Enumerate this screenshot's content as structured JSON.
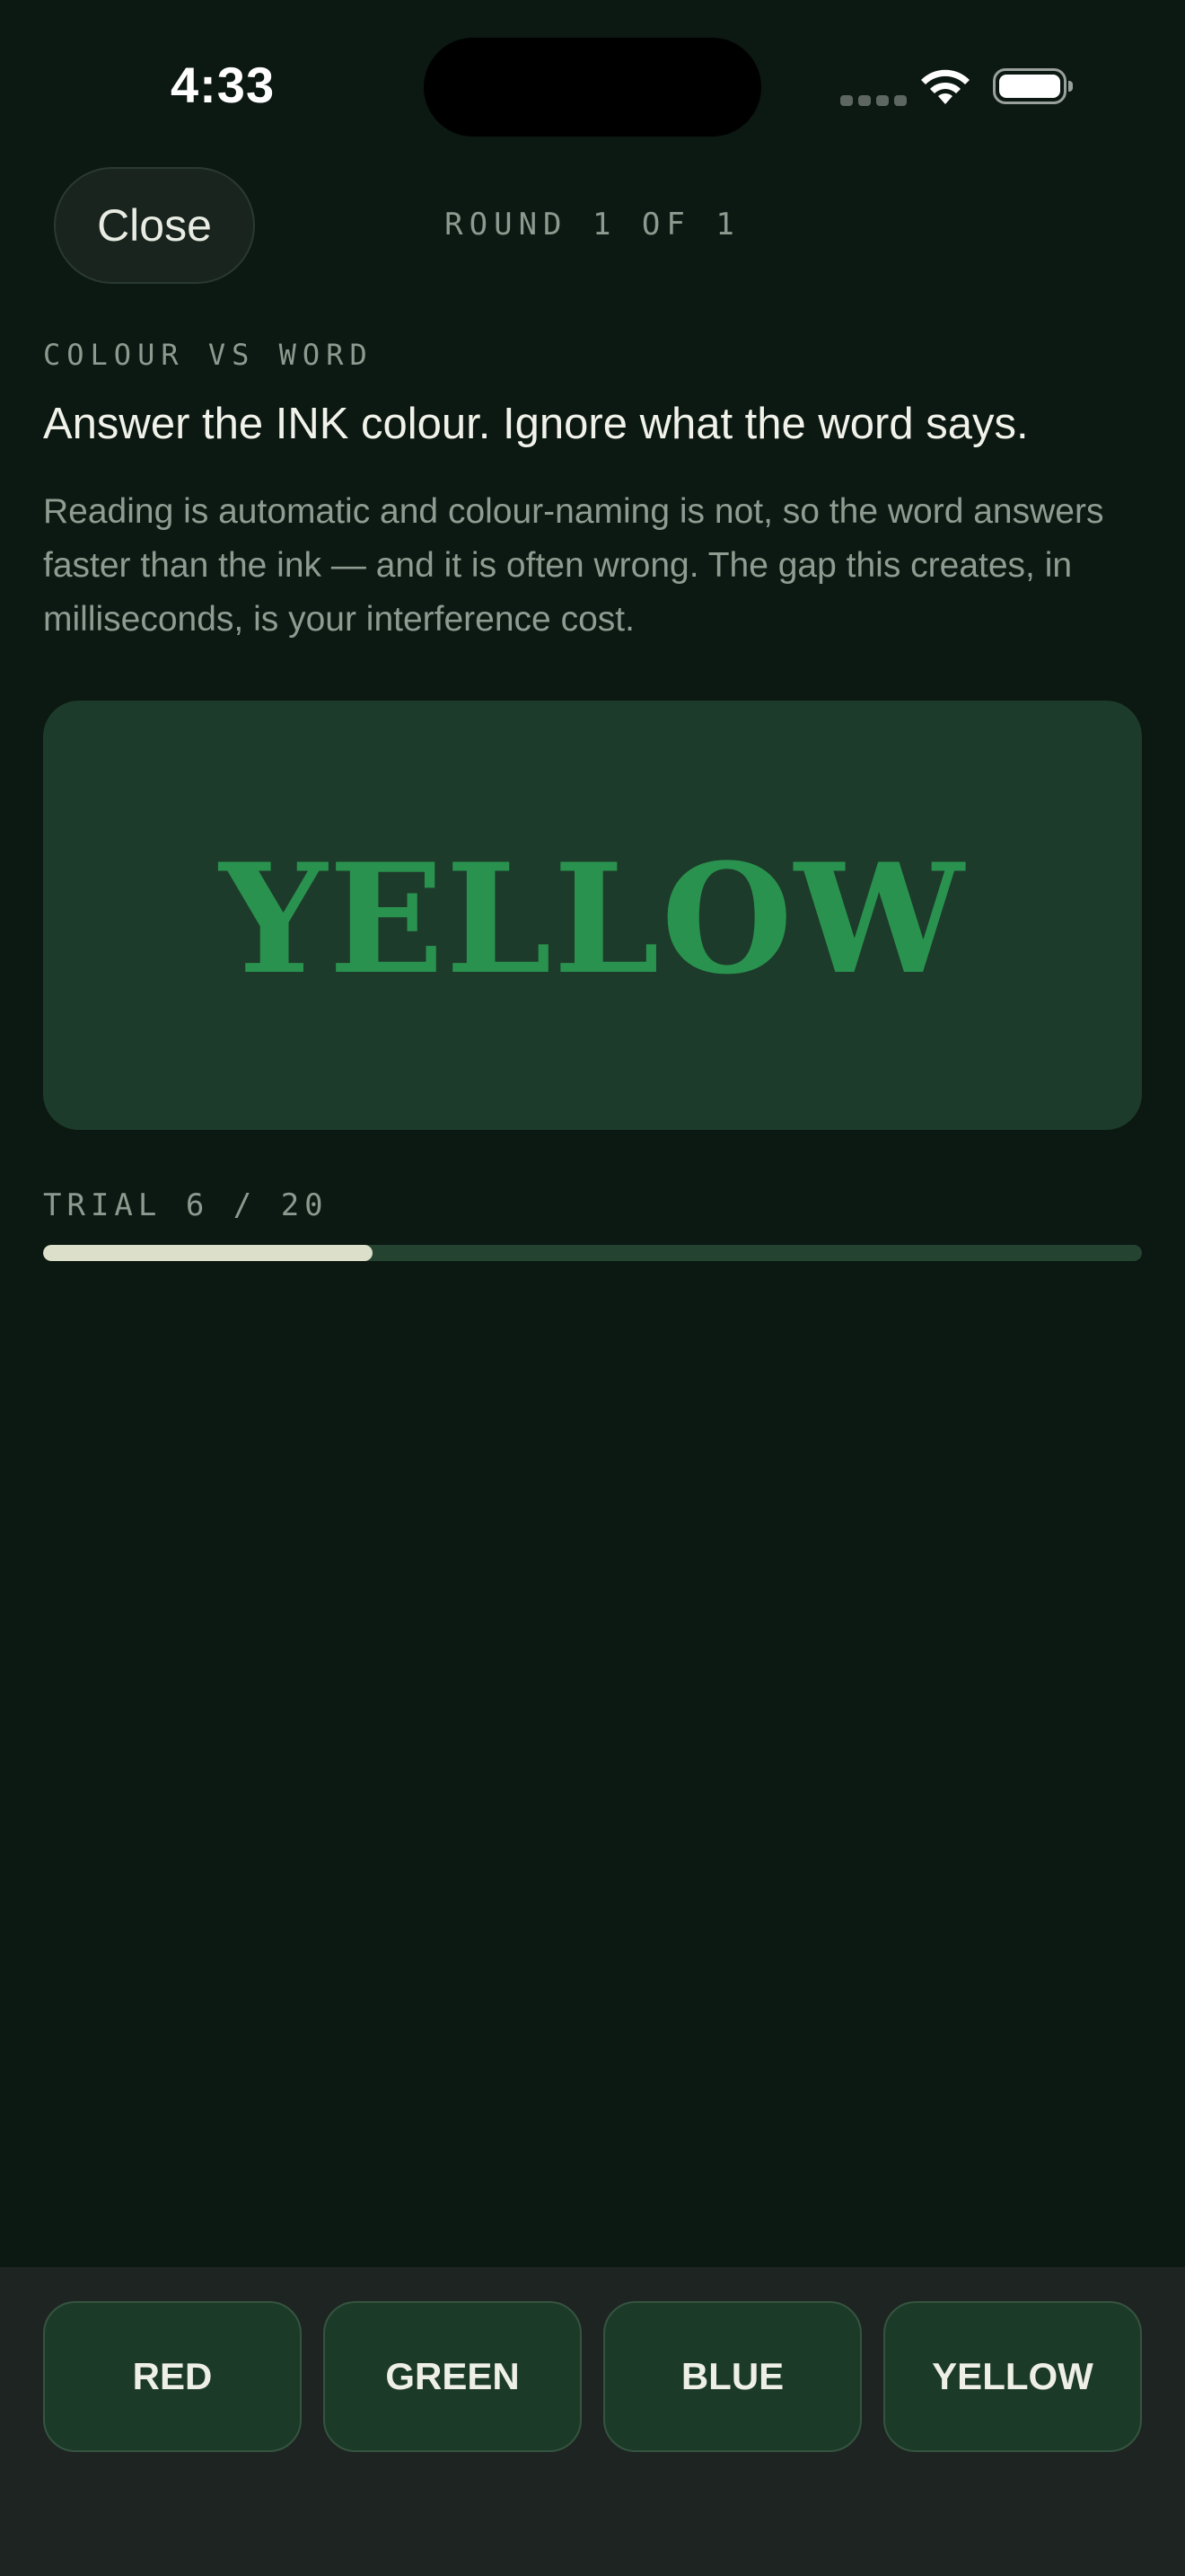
{
  "status_bar": {
    "time": "4:33"
  },
  "header": {
    "close_label": "Close",
    "round_label": "ROUND 1 OF 1"
  },
  "task": {
    "eyebrow": "COLOUR VS WORD",
    "instruction": "Answer the INK colour. Ignore what the word says.",
    "explanation": "Reading is automatic and colour-naming is not, so the word answers faster than the ink — and it is often wrong. The gap this creates, in milliseconds, is your interference cost."
  },
  "stimulus": {
    "word": "YELLOW",
    "ink_color": "#2a924f"
  },
  "progress": {
    "label": "TRIAL 6 / 20",
    "current": 6,
    "total": 20,
    "fraction": 0.3
  },
  "answers": [
    {
      "label": "RED"
    },
    {
      "label": "GREEN"
    },
    {
      "label": "BLUE"
    },
    {
      "label": "YELLOW"
    }
  ],
  "colors": {
    "background": "#0c1812",
    "card": "#1d3b2a",
    "button": "#1c3a28",
    "progress_fill": "#dcdfc9"
  }
}
